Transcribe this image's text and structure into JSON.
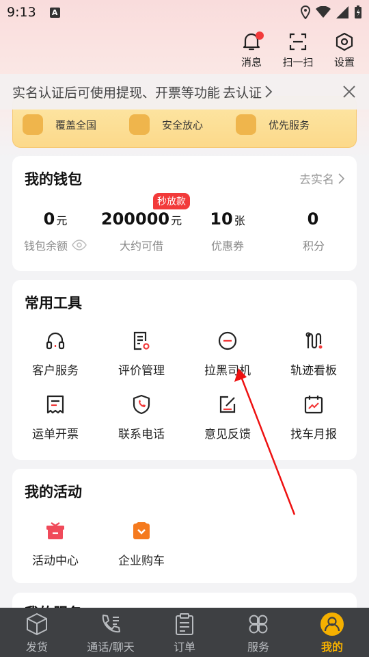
{
  "status": {
    "time": "9:13",
    "notif_letter": "A"
  },
  "header": {
    "actions": [
      {
        "label": "消息",
        "icon": "bell-icon"
      },
      {
        "label": "扫一扫",
        "icon": "scan-icon"
      },
      {
        "label": "设置",
        "icon": "gear-icon"
      }
    ]
  },
  "promo": {
    "items": [
      "覆盖全国",
      "安全放心",
      "优先服务"
    ]
  },
  "auth_banner": {
    "text": "实名认证后可使用提现、开票等功能",
    "link": "去认证"
  },
  "wallet": {
    "title": "我的钱包",
    "link": "去实名",
    "badge": "秒放款",
    "stats": [
      {
        "value": "0",
        "unit": "元",
        "label": "钱包余额"
      },
      {
        "value": "200000",
        "unit": "元",
        "label": "大约可借"
      },
      {
        "value": "10",
        "unit": "张",
        "label": "优惠券"
      },
      {
        "value": "0",
        "unit": "",
        "label": "积分"
      }
    ]
  },
  "tools": {
    "title": "常用工具",
    "items": [
      {
        "label": "客户服务",
        "icon": "headset-icon"
      },
      {
        "label": "评价管理",
        "icon": "review-icon"
      },
      {
        "label": "拉黑司机",
        "icon": "block-icon"
      },
      {
        "label": "轨迹看板",
        "icon": "track-icon"
      },
      {
        "label": "运单开票",
        "icon": "invoice-icon"
      },
      {
        "label": "联系电话",
        "icon": "phone-shield-icon"
      },
      {
        "label": "意见反馈",
        "icon": "feedback-icon"
      },
      {
        "label": "找车月报",
        "icon": "report-icon"
      }
    ]
  },
  "activities": {
    "title": "我的活动",
    "items": [
      {
        "label": "活动中心",
        "icon": "gift-icon"
      },
      {
        "label": "企业购车",
        "icon": "car-purchase-icon"
      }
    ]
  },
  "services": {
    "title": "我的服务"
  },
  "tabbar": {
    "tabs": [
      {
        "label": "发货",
        "icon": "box-icon"
      },
      {
        "label": "通话/聊天",
        "icon": "call-icon"
      },
      {
        "label": "订单",
        "icon": "order-icon"
      },
      {
        "label": "服务",
        "icon": "service-icon"
      },
      {
        "label": "我的",
        "icon": "profile-icon"
      }
    ]
  },
  "colors": {
    "accent": "#f5b000",
    "red": "#f23a3a",
    "tabbar_bg": "#3e4043"
  }
}
